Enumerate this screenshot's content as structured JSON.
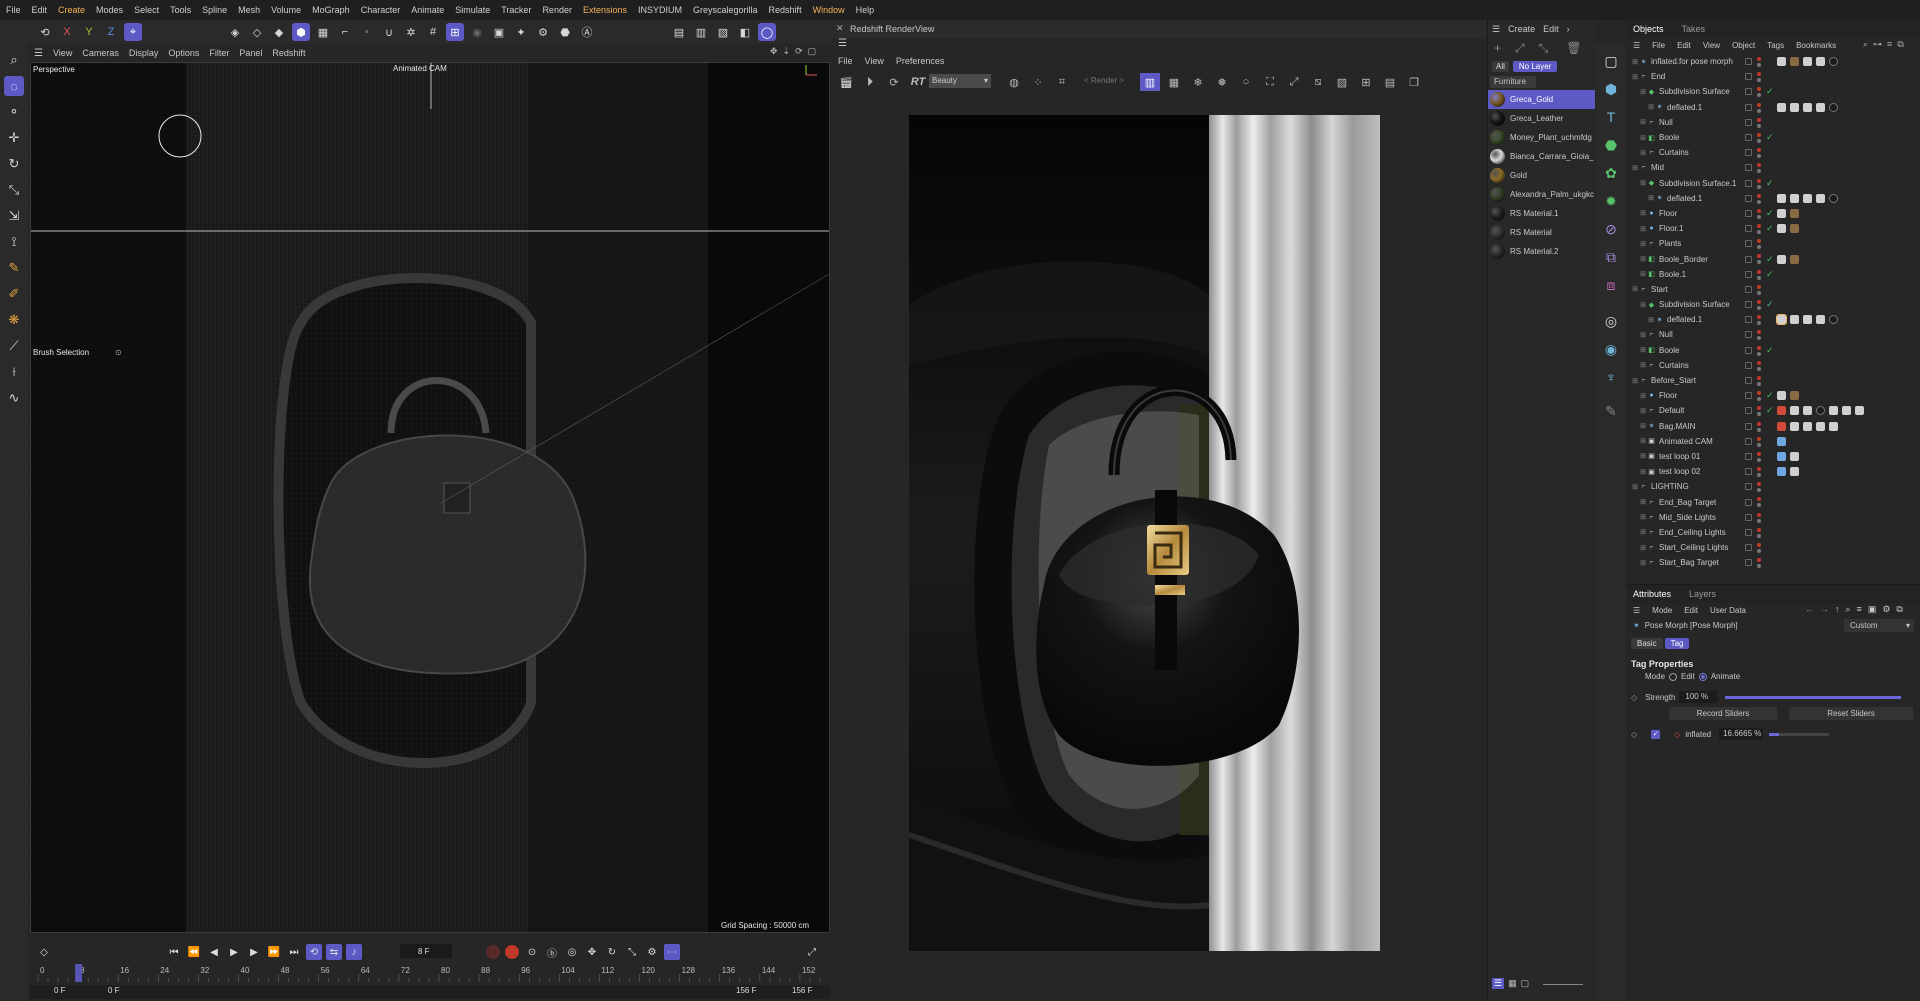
{
  "menubar": [
    "File",
    "Edit",
    "Create",
    "Modes",
    "Select",
    "Tools",
    "Spline",
    "Mesh",
    "Volume",
    "MoGraph",
    "Character",
    "Animate",
    "Simulate",
    "Tracker",
    "Render",
    "Extensions",
    "INSYDIUM",
    "Greyscalegorilla",
    "Redshift",
    "Window",
    "Help"
  ],
  "menubar_highlight": [
    "Create",
    "Extensions",
    "Window"
  ],
  "toolbar_axes": [
    "X",
    "Y",
    "Z"
  ],
  "viewport": {
    "menu": [
      "View",
      "Cameras",
      "Display",
      "Options",
      "Filter",
      "Panel",
      "Redshift"
    ],
    "label": "Perspective",
    "camera": "Animated CAM",
    "brush": "Brush Selection",
    "grid_spacing": "Grid Spacing : 50000 cm"
  },
  "timeline": {
    "current_frame": "8 F",
    "ticks": [
      "0",
      "8",
      "16",
      "24",
      "32",
      "40",
      "48",
      "56",
      "64",
      "72",
      "80",
      "88",
      "96",
      "104",
      "112",
      "120",
      "128",
      "136",
      "144",
      "152"
    ],
    "start": "0 F",
    "start2": "0 F",
    "end": "156 F",
    "end2": "156 F"
  },
  "renderview": {
    "title": "Redshift RenderView",
    "menu": [
      "File",
      "View",
      "Preferences"
    ],
    "aov": "Beauty",
    "rt": "RT",
    "render_label": "< Render >"
  },
  "materials": {
    "menu": [
      "Create",
      "Edit"
    ],
    "filter_all": "All",
    "filter_layer": "No Layer",
    "group": "Furniture",
    "items": [
      {
        "name": "Greca_Gold",
        "selected": true,
        "color": "#7a5a20"
      },
      {
        "name": "Greca_Leather",
        "selected": false,
        "color": "#151515"
      },
      {
        "name": "Money_Plant_uchmfdg",
        "selected": false,
        "color": "#3a4a2a"
      },
      {
        "name": "Bianca_Carrara_Gioia_",
        "selected": false,
        "color": "#d8d8d8"
      },
      {
        "name": "Gold",
        "selected": false,
        "color": "#8a6a24"
      },
      {
        "name": "Alexandra_Palm_ukgkc",
        "selected": false,
        "color": "#324026"
      },
      {
        "name": "RS Material.1",
        "selected": false,
        "color": "#202020"
      },
      {
        "name": "RS Material",
        "selected": false,
        "color": "#303030"
      },
      {
        "name": "RS Material.2",
        "selected": false,
        "color": "#2a2a2a"
      }
    ]
  },
  "objects": {
    "tabs": [
      "Objects",
      "Takes"
    ],
    "menu": [
      "File",
      "Edit",
      "View",
      "Object",
      "Tags",
      "Bookmarks"
    ],
    "rows": [
      {
        "name": "inflated.for pose morph",
        "depth": 0,
        "icon": "morph",
        "check": false,
        "tags": [
          "w",
          "img",
          "w",
          "w",
          "dark"
        ]
      },
      {
        "name": "End",
        "depth": 0,
        "icon": "null",
        "check": false,
        "tags": []
      },
      {
        "name": "Subdivision Surface",
        "depth": 1,
        "icon": "subd",
        "check": true,
        "tags": []
      },
      {
        "name": "deflated.1",
        "depth": 2,
        "icon": "morph",
        "check": false,
        "tags": [
          "w",
          "w",
          "w",
          "w",
          "dark"
        ]
      },
      {
        "name": "Null",
        "depth": 1,
        "icon": "null",
        "check": false,
        "tags": []
      },
      {
        "name": "Boole",
        "depth": 1,
        "icon": "boole",
        "check": true,
        "tags": []
      },
      {
        "name": "Curtains",
        "depth": 1,
        "icon": "null",
        "check": false,
        "tags": []
      },
      {
        "name": "Mid",
        "depth": 0,
        "icon": "null",
        "check": false,
        "tags": []
      },
      {
        "name": "Subdivision Surface.1",
        "depth": 1,
        "icon": "subd",
        "check": true,
        "tags": []
      },
      {
        "name": "deflated.1",
        "depth": 2,
        "icon": "morph",
        "check": false,
        "tags": [
          "w",
          "w",
          "w",
          "w",
          "dark"
        ]
      },
      {
        "name": "Floor",
        "depth": 1,
        "icon": "floor",
        "check": true,
        "tags": [
          "w",
          "img"
        ]
      },
      {
        "name": "Floor.1",
        "depth": 1,
        "icon": "floor",
        "check": true,
        "tags": [
          "w",
          "img"
        ]
      },
      {
        "name": "Plants",
        "depth": 1,
        "icon": "null",
        "check": false,
        "tags": []
      },
      {
        "name": "Boole_Border",
        "depth": 1,
        "icon": "boole",
        "check": true,
        "tags": [
          "w",
          "img"
        ]
      },
      {
        "name": "Boole.1",
        "depth": 1,
        "icon": "boole",
        "check": true,
        "tags": []
      },
      {
        "name": "Start",
        "depth": 0,
        "icon": "null",
        "check": false,
        "tags": []
      },
      {
        "name": "Subdivision Surface",
        "depth": 1,
        "icon": "subd",
        "check": true,
        "tags": []
      },
      {
        "name": "deflated.1",
        "depth": 2,
        "icon": "morph",
        "check": false,
        "tags": [
          "sel",
          "w",
          "w",
          "w",
          "dark"
        ]
      },
      {
        "name": "Null",
        "depth": 1,
        "icon": "null",
        "check": false,
        "tags": []
      },
      {
        "name": "Boole",
        "depth": 1,
        "icon": "boole",
        "check": true,
        "tags": []
      },
      {
        "name": "Curtains",
        "depth": 1,
        "icon": "null",
        "check": false,
        "tags": []
      },
      {
        "name": "Before_Start",
        "depth": 0,
        "icon": "null",
        "check": false,
        "tags": []
      },
      {
        "name": "Floor",
        "depth": 1,
        "icon": "floor",
        "check": true,
        "tags": [
          "w",
          "img"
        ]
      },
      {
        "name": "Default",
        "depth": 1,
        "icon": "null",
        "check": true,
        "tags": [
          "red",
          "w",
          "w",
          "dark",
          "w",
          "w",
          "w"
        ]
      },
      {
        "name": "Bag.MAIN",
        "depth": 1,
        "icon": "morph",
        "check": false,
        "tags": [
          "red",
          "w",
          "w",
          "w",
          "w"
        ]
      },
      {
        "name": "Animated CAM",
        "depth": 1,
        "icon": "cam",
        "check": false,
        "tags": [
          "cam"
        ]
      },
      {
        "name": "test loop 01",
        "depth": 1,
        "icon": "cam",
        "check": false,
        "tags": [
          "cam",
          "w"
        ]
      },
      {
        "name": "test loop 02",
        "depth": 1,
        "icon": "cam",
        "check": false,
        "tags": [
          "cam",
          "w"
        ]
      },
      {
        "name": "LIGHTING",
        "depth": 0,
        "icon": "null",
        "check": false,
        "tags": []
      },
      {
        "name": "End_Bag Target",
        "depth": 1,
        "icon": "null",
        "check": false,
        "tags": []
      },
      {
        "name": "Mid_Side Lights",
        "depth": 1,
        "icon": "null",
        "check": false,
        "tags": []
      },
      {
        "name": "End_Ceiling Lights",
        "depth": 1,
        "icon": "null",
        "check": false,
        "tags": []
      },
      {
        "name": "Start_Ceiling Lights",
        "depth": 1,
        "icon": "null",
        "check": false,
        "tags": []
      },
      {
        "name": "Start_Bag Target",
        "depth": 1,
        "icon": "null",
        "check": false,
        "tags": []
      }
    ]
  },
  "attributes": {
    "tabs": [
      "Attributes",
      "Layers"
    ],
    "menu": [
      "Mode",
      "Edit",
      "User Data"
    ],
    "title": "Pose Morph [Pose Morph]",
    "preset": "Custom",
    "subtabs": [
      "Basic",
      "Tag"
    ],
    "section": "Tag Properties",
    "mode_label": "Mode",
    "mode_edit": "Edit",
    "mode_animate": "Animate",
    "strength_label": "Strength",
    "strength_value": "100 %",
    "strength_fraction": 1.0,
    "record_button": "Record Sliders",
    "reset_button": "Reset Sliders",
    "morph_name": "inflated",
    "morph_value": "16.6665 %",
    "morph_fraction": 0.167
  }
}
